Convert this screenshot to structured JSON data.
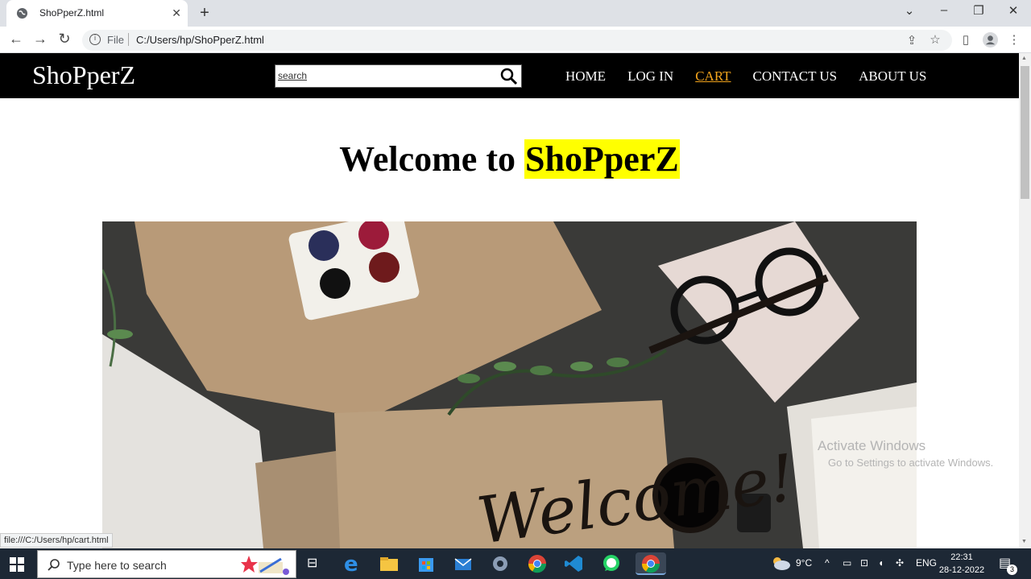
{
  "browser": {
    "tab_title": "ShoPperZ.html",
    "new_tab": "+",
    "url_scheme": "File",
    "url": "C:/Users/hp/ShoPperZ.html",
    "status_link": "file:///C:/Users/hp/cart.html"
  },
  "site": {
    "logo": "ShoPperZ",
    "search_placeholder": "search",
    "nav": [
      {
        "label": "HOME"
      },
      {
        "label": "LOG IN"
      },
      {
        "label": "CART",
        "active": true
      },
      {
        "label": "CONTACT US"
      },
      {
        "label": "ABOUT US"
      }
    ],
    "welcome_prefix": "Welcome to ",
    "welcome_highlight": "ShoPperZ",
    "hero_text": "Welcome!"
  },
  "watermark": {
    "line1": "Activate Windows",
    "line2": "Go to Settings to activate Windows."
  },
  "taskbar": {
    "search_placeholder": "Type here to search",
    "weather": "9°C",
    "language": "ENG",
    "time": "22:31",
    "date": "28-12-2022",
    "notification_count": "3"
  },
  "colors": {
    "nav_bg": "#000000",
    "cart_active": "#f4a51c",
    "highlight": "#ffff00",
    "taskbar_bg": "#1d2835"
  }
}
